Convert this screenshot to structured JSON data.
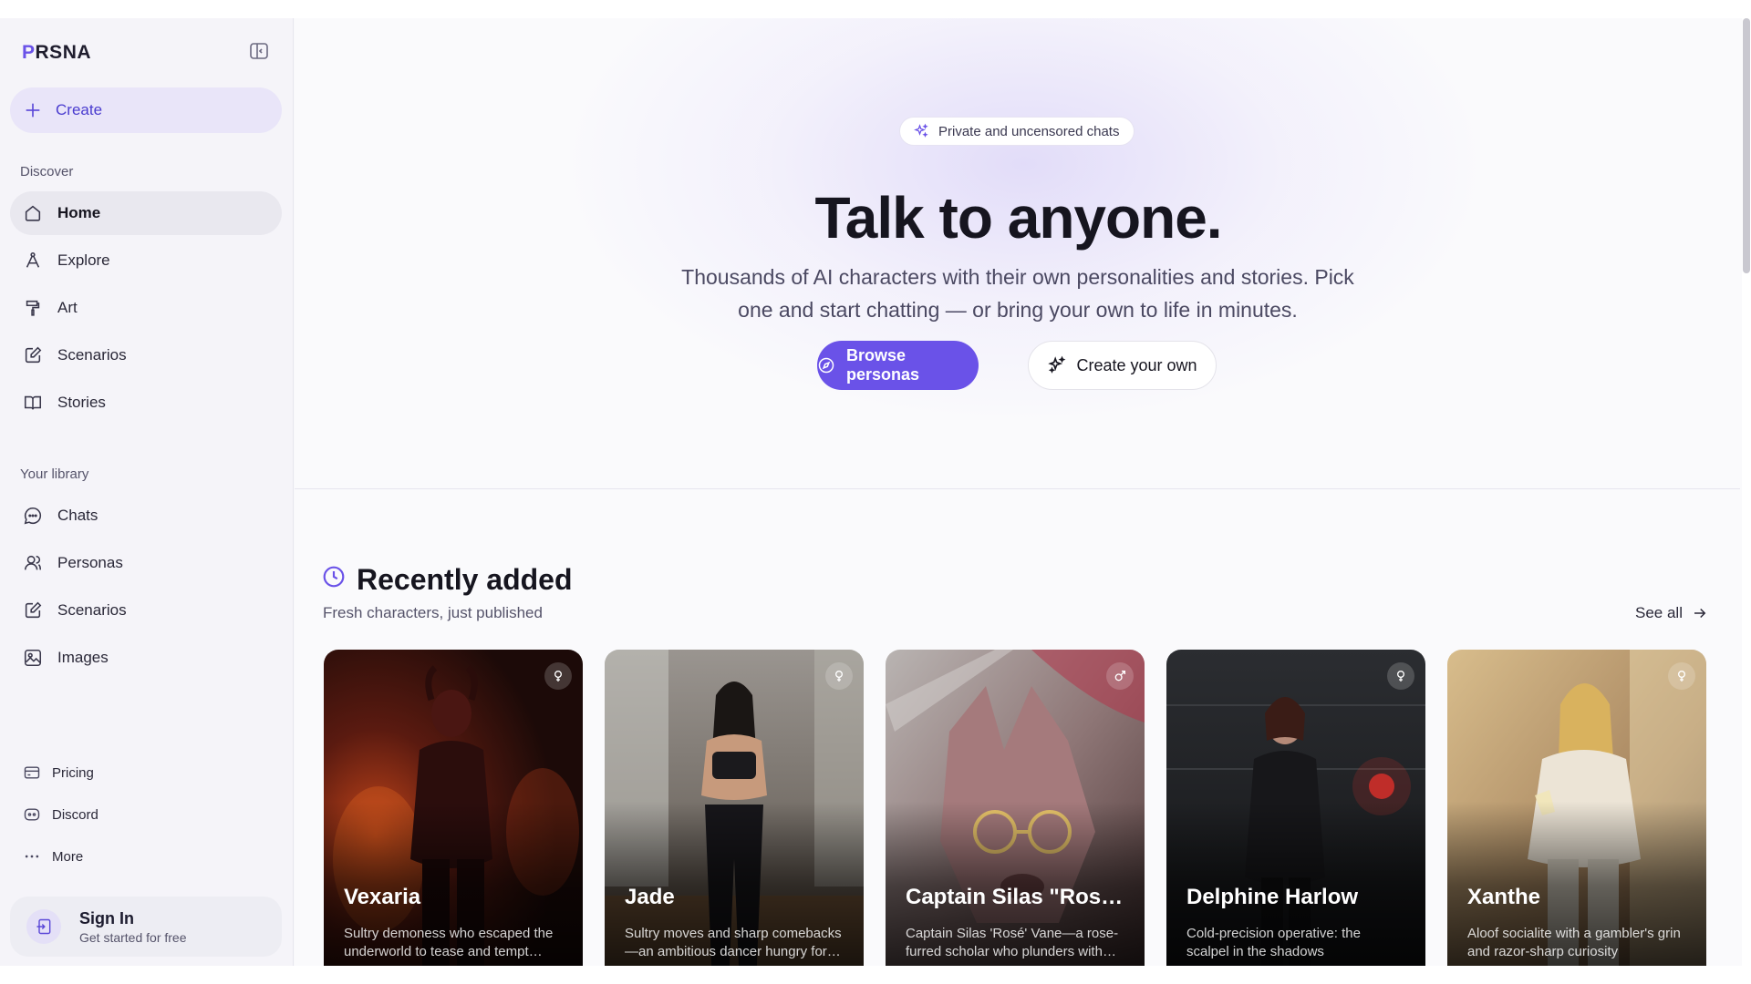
{
  "sidebar": {
    "logo_p": "P",
    "logo_rest": "RSNA",
    "create_label": "Create",
    "discover_label": "Discover",
    "discover_items": [
      {
        "label": "Home",
        "icon": "home-icon"
      },
      {
        "label": "Explore",
        "icon": "compass-pen-icon"
      },
      {
        "label": "Art",
        "icon": "brush-icon"
      },
      {
        "label": "Scenarios",
        "icon": "edit-icon"
      },
      {
        "label": "Stories",
        "icon": "book-icon"
      }
    ],
    "library_label": "Your library",
    "library_items": [
      {
        "label": "Chats",
        "icon": "chat-icon"
      },
      {
        "label": "Personas",
        "icon": "users-icon"
      },
      {
        "label": "Scenarios",
        "icon": "edit-icon"
      },
      {
        "label": "Images",
        "icon": "image-icon"
      }
    ],
    "footer_items": [
      {
        "label": "Pricing",
        "icon": "credit-card-icon"
      },
      {
        "label": "Discord",
        "icon": "discord-icon"
      },
      {
        "label": "More",
        "icon": "more-icon"
      }
    ],
    "signin": {
      "title": "Sign In",
      "subtitle": "Get started for free"
    }
  },
  "hero": {
    "pill": "Private and uncensored chats",
    "title": "Talk to anyone.",
    "subtitle": "Thousands of AI characters with their own personalities and stories. Pick one and start chatting — or bring your own to life in minutes.",
    "browse_label": "Browse personas",
    "create_label": "Create your own"
  },
  "recent": {
    "title": "Recently added",
    "subtitle": "Fresh characters, just published",
    "see_all": "See all",
    "cards": [
      {
        "name": "Vexaria",
        "desc": "Sultry demoness who escaped the underworld to tease and tempt…",
        "gender": "female"
      },
      {
        "name": "Jade",
        "desc": "Sultry moves and sharp comebacks—an ambitious dancer hungry for…",
        "gender": "female"
      },
      {
        "name": "Captain Silas \"Rosé\"…",
        "desc": "Captain Silas 'Rosé' Vane—a rose-furred scholar who plunders with…",
        "gender": "male"
      },
      {
        "name": "Delphine Harlow",
        "desc": "Cold-precision operative: the scalpel in the shadows",
        "gender": "female"
      },
      {
        "name": "Xanthe",
        "desc": "Aloof socialite with a gambler's grin and razor-sharp curiosity",
        "gender": "female"
      }
    ]
  },
  "colors": {
    "accent": "#6a52e8",
    "sidebar_bg": "#f5f4f9",
    "page_bg": "#fafafc"
  }
}
